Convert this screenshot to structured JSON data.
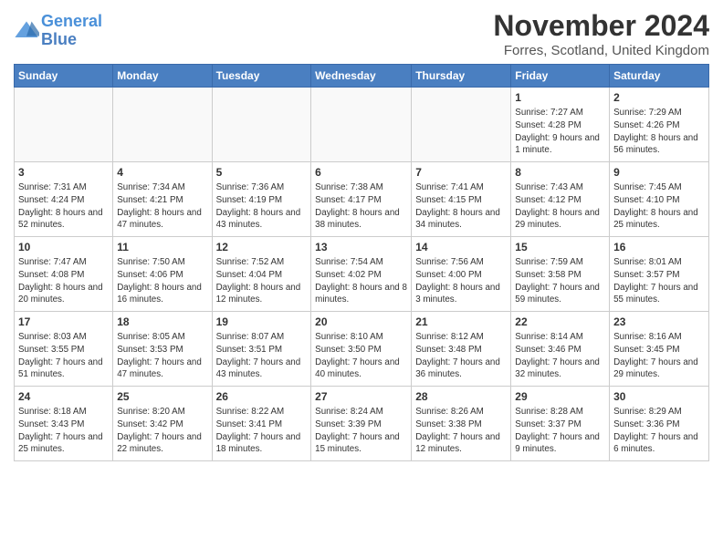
{
  "header": {
    "logo_line1": "General",
    "logo_line2": "Blue",
    "title": "November 2024",
    "subtitle": "Forres, Scotland, United Kingdom"
  },
  "weekdays": [
    "Sunday",
    "Monday",
    "Tuesday",
    "Wednesday",
    "Thursday",
    "Friday",
    "Saturday"
  ],
  "weeks": [
    [
      {
        "day": "",
        "info": ""
      },
      {
        "day": "",
        "info": ""
      },
      {
        "day": "",
        "info": ""
      },
      {
        "day": "",
        "info": ""
      },
      {
        "day": "",
        "info": ""
      },
      {
        "day": "1",
        "info": "Sunrise: 7:27 AM\nSunset: 4:28 PM\nDaylight: 9 hours\nand 1 minute."
      },
      {
        "day": "2",
        "info": "Sunrise: 7:29 AM\nSunset: 4:26 PM\nDaylight: 8 hours\nand 56 minutes."
      }
    ],
    [
      {
        "day": "3",
        "info": "Sunrise: 7:31 AM\nSunset: 4:24 PM\nDaylight: 8 hours\nand 52 minutes."
      },
      {
        "day": "4",
        "info": "Sunrise: 7:34 AM\nSunset: 4:21 PM\nDaylight: 8 hours\nand 47 minutes."
      },
      {
        "day": "5",
        "info": "Sunrise: 7:36 AM\nSunset: 4:19 PM\nDaylight: 8 hours\nand 43 minutes."
      },
      {
        "day": "6",
        "info": "Sunrise: 7:38 AM\nSunset: 4:17 PM\nDaylight: 8 hours\nand 38 minutes."
      },
      {
        "day": "7",
        "info": "Sunrise: 7:41 AM\nSunset: 4:15 PM\nDaylight: 8 hours\nand 34 minutes."
      },
      {
        "day": "8",
        "info": "Sunrise: 7:43 AM\nSunset: 4:12 PM\nDaylight: 8 hours\nand 29 minutes."
      },
      {
        "day": "9",
        "info": "Sunrise: 7:45 AM\nSunset: 4:10 PM\nDaylight: 8 hours\nand 25 minutes."
      }
    ],
    [
      {
        "day": "10",
        "info": "Sunrise: 7:47 AM\nSunset: 4:08 PM\nDaylight: 8 hours\nand 20 minutes."
      },
      {
        "day": "11",
        "info": "Sunrise: 7:50 AM\nSunset: 4:06 PM\nDaylight: 8 hours\nand 16 minutes."
      },
      {
        "day": "12",
        "info": "Sunrise: 7:52 AM\nSunset: 4:04 PM\nDaylight: 8 hours\nand 12 minutes."
      },
      {
        "day": "13",
        "info": "Sunrise: 7:54 AM\nSunset: 4:02 PM\nDaylight: 8 hours\nand 8 minutes."
      },
      {
        "day": "14",
        "info": "Sunrise: 7:56 AM\nSunset: 4:00 PM\nDaylight: 8 hours\nand 3 minutes."
      },
      {
        "day": "15",
        "info": "Sunrise: 7:59 AM\nSunset: 3:58 PM\nDaylight: 7 hours\nand 59 minutes."
      },
      {
        "day": "16",
        "info": "Sunrise: 8:01 AM\nSunset: 3:57 PM\nDaylight: 7 hours\nand 55 minutes."
      }
    ],
    [
      {
        "day": "17",
        "info": "Sunrise: 8:03 AM\nSunset: 3:55 PM\nDaylight: 7 hours\nand 51 minutes."
      },
      {
        "day": "18",
        "info": "Sunrise: 8:05 AM\nSunset: 3:53 PM\nDaylight: 7 hours\nand 47 minutes."
      },
      {
        "day": "19",
        "info": "Sunrise: 8:07 AM\nSunset: 3:51 PM\nDaylight: 7 hours\nand 43 minutes."
      },
      {
        "day": "20",
        "info": "Sunrise: 8:10 AM\nSunset: 3:50 PM\nDaylight: 7 hours\nand 40 minutes."
      },
      {
        "day": "21",
        "info": "Sunrise: 8:12 AM\nSunset: 3:48 PM\nDaylight: 7 hours\nand 36 minutes."
      },
      {
        "day": "22",
        "info": "Sunrise: 8:14 AM\nSunset: 3:46 PM\nDaylight: 7 hours\nand 32 minutes."
      },
      {
        "day": "23",
        "info": "Sunrise: 8:16 AM\nSunset: 3:45 PM\nDaylight: 7 hours\nand 29 minutes."
      }
    ],
    [
      {
        "day": "24",
        "info": "Sunrise: 8:18 AM\nSunset: 3:43 PM\nDaylight: 7 hours\nand 25 minutes."
      },
      {
        "day": "25",
        "info": "Sunrise: 8:20 AM\nSunset: 3:42 PM\nDaylight: 7 hours\nand 22 minutes."
      },
      {
        "day": "26",
        "info": "Sunrise: 8:22 AM\nSunset: 3:41 PM\nDaylight: 7 hours\nand 18 minutes."
      },
      {
        "day": "27",
        "info": "Sunrise: 8:24 AM\nSunset: 3:39 PM\nDaylight: 7 hours\nand 15 minutes."
      },
      {
        "day": "28",
        "info": "Sunrise: 8:26 AM\nSunset: 3:38 PM\nDaylight: 7 hours\nand 12 minutes."
      },
      {
        "day": "29",
        "info": "Sunrise: 8:28 AM\nSunset: 3:37 PM\nDaylight: 7 hours\nand 9 minutes."
      },
      {
        "day": "30",
        "info": "Sunrise: 8:29 AM\nSunset: 3:36 PM\nDaylight: 7 hours\nand 6 minutes."
      }
    ]
  ]
}
